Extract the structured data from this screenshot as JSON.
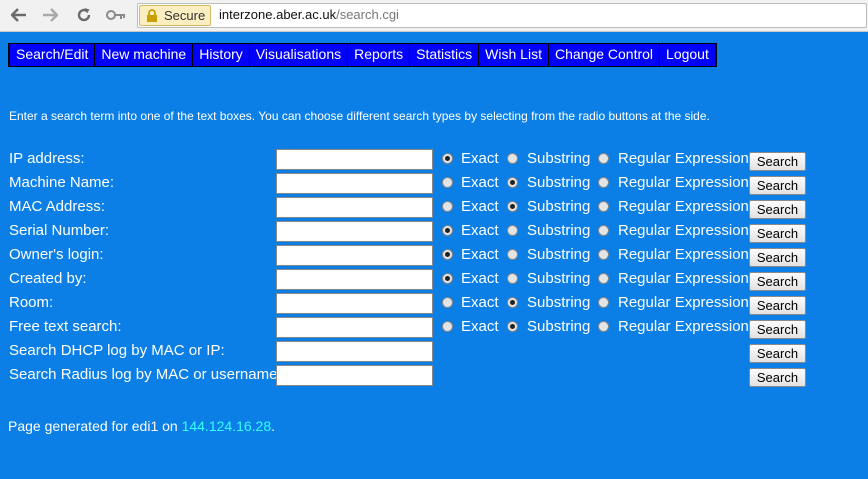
{
  "browser": {
    "secure_label": "Secure",
    "url_host": "interzone.aber.ac.uk",
    "url_path": "/search.cgi",
    "icons": [
      "back-arrow-icon",
      "forward-arrow-icon",
      "reload-icon",
      "key-icon",
      "lock-icon"
    ]
  },
  "menu": {
    "items": [
      {
        "label": "Search/Edit"
      },
      {
        "label": "New machine"
      },
      {
        "label": "History"
      },
      {
        "label": "Visualisations"
      },
      {
        "label": "Reports"
      },
      {
        "label": "Statistics"
      },
      {
        "label": "Wish List"
      },
      {
        "label": "Change Control"
      },
      {
        "label": "Logout"
      }
    ]
  },
  "intro": "Enter a search term into one of the text boxes. You can choose different search types by selecting from the radio buttons at the side.",
  "radio_labels": {
    "exact": "Exact",
    "substring": "Substring",
    "regex": "Regular Expression"
  },
  "search_button_label": "Search",
  "rows": [
    {
      "label": "IP address:",
      "selected": "exact",
      "value": ""
    },
    {
      "label": "Machine Name:",
      "selected": "substring",
      "value": ""
    },
    {
      "label": "MAC Address:",
      "selected": "substring",
      "value": ""
    },
    {
      "label": "Serial Number:",
      "selected": "exact",
      "value": ""
    },
    {
      "label": "Owner's login:",
      "selected": "exact",
      "value": ""
    },
    {
      "label": "Created by:",
      "selected": "exact",
      "value": ""
    },
    {
      "label": "Room:",
      "selected": "substring",
      "value": ""
    },
    {
      "label": "Free text search:",
      "selected": "substring",
      "value": ""
    },
    {
      "label": "Search DHCP log by MAC or IP:",
      "selected": null,
      "value": ""
    },
    {
      "label": "Search Radius log by MAC or username:",
      "selected": null,
      "value": ""
    }
  ],
  "footer": {
    "prefix": "Page generated for edi1 on ",
    "ip": "144.124.16.28",
    "suffix": "."
  },
  "colors": {
    "background": "#0b7fe6",
    "menu_bg": "#0000ff",
    "link": "#33ffff"
  }
}
